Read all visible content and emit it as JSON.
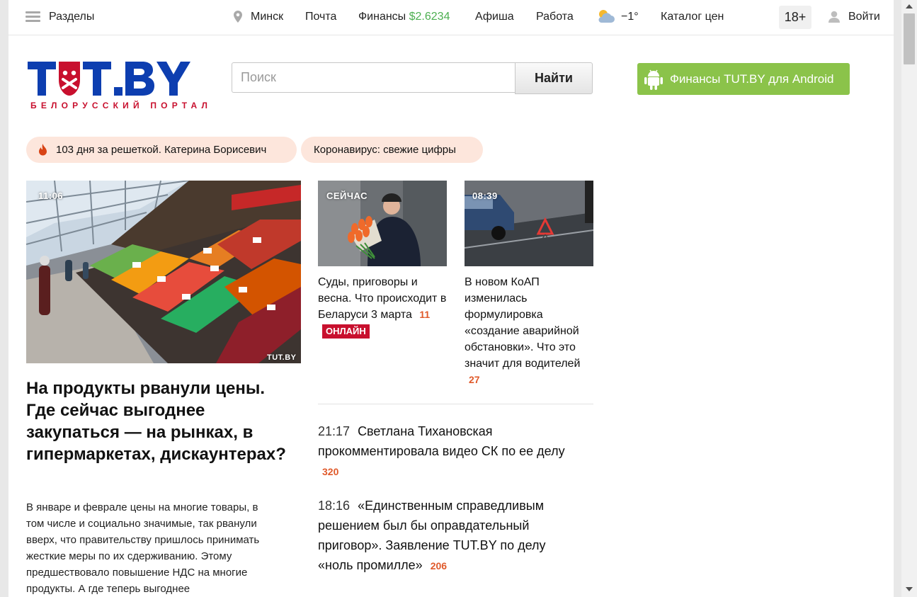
{
  "topbar": {
    "sections_label": "Разделы",
    "city": "Минск",
    "mail": "Почта",
    "finance": "Финансы",
    "finance_value": "$2.6234",
    "afisha": "Афиша",
    "jobs": "Работа",
    "temperature": "−1°",
    "catalog": "Каталог цен",
    "age_rating": "18+",
    "login": "Войти"
  },
  "header": {
    "logo_text": "TUT.BY",
    "logo_subtitle": "БЕЛОРУССКИЙ ПОРТАЛ",
    "search_placeholder": "Поиск",
    "search_button": "Найти",
    "promo_button": "Финансы TUT.BY для Android"
  },
  "chips": [
    {
      "label": "103 дня за решеткой. Катерина Борисевич"
    },
    {
      "label": "Коронавирус: свежие цифры"
    }
  ],
  "main_story": {
    "time": "11:06",
    "watermark": "TUT.BY",
    "title": "На продукты рванули цены. Где сейчас выгоднее закупаться — на рынках, в гипермаркетах, дискаунтерах?",
    "lead": "В январе и феврале цены на многие товары, в том числе и социально значимые, так рванули вверх, что правительству пришлось принимать жесткие меры по их сдерживанию. Этому предшествовало повышение НДС на многие продукты. А где теперь выгоднее"
  },
  "cards": [
    {
      "overlay": "СЕЙЧАС",
      "title": "Суды, приговоры и весна. Что происходит в Беларуси 3 марта",
      "count": "11",
      "badge": "ОНЛАЙН"
    },
    {
      "overlay": "08:39",
      "title": "В новом КоАП изменилась формулировка «создание аварийной обстановки». Что это значит для водителей",
      "count": "27"
    }
  ],
  "news": [
    {
      "time": "21:17",
      "title": "Светлана Тихановская прокомментировала видео СК по ее делу",
      "count": "320"
    },
    {
      "time": "18:16",
      "title": "«Единственным справедливым решением был бы оправдательный приговор». Заявление TUT.BY по делу «ноль промилле»",
      "count": "206"
    }
  ],
  "colors": {
    "brand_blue": "#0d3eb0",
    "brand_red": "#c8102e",
    "finance_green": "#4caf50",
    "android_green": "#8bc34a",
    "chip_bg": "#fde6dc",
    "count_color": "#e05a2b"
  },
  "icons": {
    "menu": "hamburger-icon",
    "location": "map-pin-icon",
    "weather": "cloud-sun-icon",
    "user": "user-icon",
    "android": "android-icon",
    "hot": "flame-icon"
  }
}
